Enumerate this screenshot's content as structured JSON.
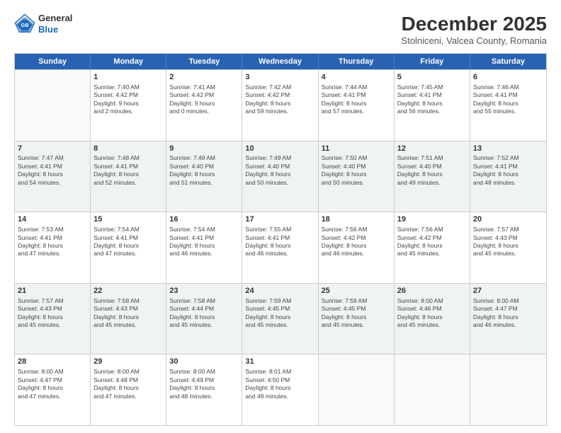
{
  "header": {
    "logo_line1": "General",
    "logo_line2": "Blue",
    "month": "December 2025",
    "location": "Stolniceni, Valcea County, Romania"
  },
  "days": [
    "Sunday",
    "Monday",
    "Tuesday",
    "Wednesday",
    "Thursday",
    "Friday",
    "Saturday"
  ],
  "rows": [
    [
      {
        "day": "",
        "info": ""
      },
      {
        "day": "1",
        "info": "Sunrise: 7:40 AM\nSunset: 4:42 PM\nDaylight: 9 hours\nand 2 minutes."
      },
      {
        "day": "2",
        "info": "Sunrise: 7:41 AM\nSunset: 4:42 PM\nDaylight: 9 hours\nand 0 minutes."
      },
      {
        "day": "3",
        "info": "Sunrise: 7:42 AM\nSunset: 4:42 PM\nDaylight: 8 hours\nand 59 minutes."
      },
      {
        "day": "4",
        "info": "Sunrise: 7:44 AM\nSunset: 4:41 PM\nDaylight: 8 hours\nand 57 minutes."
      },
      {
        "day": "5",
        "info": "Sunrise: 7:45 AM\nSunset: 4:41 PM\nDaylight: 8 hours\nand 56 minutes."
      },
      {
        "day": "6",
        "info": "Sunrise: 7:46 AM\nSunset: 4:41 PM\nDaylight: 8 hours\nand 55 minutes."
      }
    ],
    [
      {
        "day": "7",
        "info": "Sunrise: 7:47 AM\nSunset: 4:41 PM\nDaylight: 8 hours\nand 54 minutes."
      },
      {
        "day": "8",
        "info": "Sunrise: 7:48 AM\nSunset: 4:41 PM\nDaylight: 8 hours\nand 52 minutes."
      },
      {
        "day": "9",
        "info": "Sunrise: 7:49 AM\nSunset: 4:40 PM\nDaylight: 8 hours\nand 51 minutes."
      },
      {
        "day": "10",
        "info": "Sunrise: 7:49 AM\nSunset: 4:40 PM\nDaylight: 8 hours\nand 50 minutes."
      },
      {
        "day": "11",
        "info": "Sunrise: 7:50 AM\nSunset: 4:40 PM\nDaylight: 8 hours\nand 50 minutes."
      },
      {
        "day": "12",
        "info": "Sunrise: 7:51 AM\nSunset: 4:40 PM\nDaylight: 8 hours\nand 49 minutes."
      },
      {
        "day": "13",
        "info": "Sunrise: 7:52 AM\nSunset: 4:41 PM\nDaylight: 8 hours\nand 48 minutes."
      }
    ],
    [
      {
        "day": "14",
        "info": "Sunrise: 7:53 AM\nSunset: 4:41 PM\nDaylight: 8 hours\nand 47 minutes."
      },
      {
        "day": "15",
        "info": "Sunrise: 7:54 AM\nSunset: 4:41 PM\nDaylight: 8 hours\nand 47 minutes."
      },
      {
        "day": "16",
        "info": "Sunrise: 7:54 AM\nSunset: 4:41 PM\nDaylight: 8 hours\nand 46 minutes."
      },
      {
        "day": "17",
        "info": "Sunrise: 7:55 AM\nSunset: 4:41 PM\nDaylight: 8 hours\nand 46 minutes."
      },
      {
        "day": "18",
        "info": "Sunrise: 7:56 AM\nSunset: 4:42 PM\nDaylight: 8 hours\nand 46 minutes."
      },
      {
        "day": "19",
        "info": "Sunrise: 7:56 AM\nSunset: 4:42 PM\nDaylight: 8 hours\nand 45 minutes."
      },
      {
        "day": "20",
        "info": "Sunrise: 7:57 AM\nSunset: 4:43 PM\nDaylight: 8 hours\nand 45 minutes."
      }
    ],
    [
      {
        "day": "21",
        "info": "Sunrise: 7:57 AM\nSunset: 4:43 PM\nDaylight: 8 hours\nand 45 minutes."
      },
      {
        "day": "22",
        "info": "Sunrise: 7:58 AM\nSunset: 4:43 PM\nDaylight: 8 hours\nand 45 minutes."
      },
      {
        "day": "23",
        "info": "Sunrise: 7:58 AM\nSunset: 4:44 PM\nDaylight: 8 hours\nand 45 minutes."
      },
      {
        "day": "24",
        "info": "Sunrise: 7:59 AM\nSunset: 4:45 PM\nDaylight: 8 hours\nand 45 minutes."
      },
      {
        "day": "25",
        "info": "Sunrise: 7:59 AM\nSunset: 4:45 PM\nDaylight: 8 hours\nand 45 minutes."
      },
      {
        "day": "26",
        "info": "Sunrise: 8:00 AM\nSunset: 4:46 PM\nDaylight: 8 hours\nand 45 minutes."
      },
      {
        "day": "27",
        "info": "Sunrise: 8:00 AM\nSunset: 4:47 PM\nDaylight: 8 hours\nand 46 minutes."
      }
    ],
    [
      {
        "day": "28",
        "info": "Sunrise: 8:00 AM\nSunset: 4:47 PM\nDaylight: 8 hours\nand 47 minutes."
      },
      {
        "day": "29",
        "info": "Sunrise: 8:00 AM\nSunset: 4:48 PM\nDaylight: 8 hours\nand 47 minutes."
      },
      {
        "day": "30",
        "info": "Sunrise: 8:00 AM\nSunset: 4:49 PM\nDaylight: 8 hours\nand 48 minutes."
      },
      {
        "day": "31",
        "info": "Sunrise: 8:01 AM\nSunset: 4:50 PM\nDaylight: 8 hours\nand 49 minutes."
      },
      {
        "day": "",
        "info": ""
      },
      {
        "day": "",
        "info": ""
      },
      {
        "day": "",
        "info": ""
      }
    ]
  ]
}
